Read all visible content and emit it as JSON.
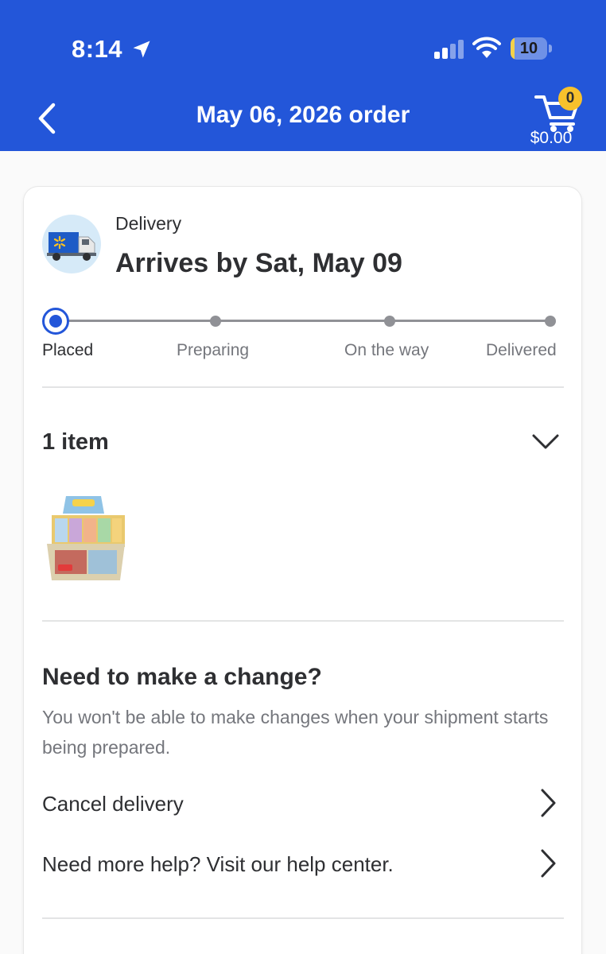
{
  "status_bar": {
    "time": "8:14",
    "battery": "10",
    "battery_level": 0.1
  },
  "header": {
    "title": "May 06, 2026 order",
    "cart_count": "0",
    "cart_total": "$0.00"
  },
  "delivery": {
    "label": "Delivery",
    "arrives": "Arrives by Sat, May 09",
    "steps": [
      "Placed",
      "Preparing",
      "On the way",
      "Delivered"
    ],
    "current_step": 0
  },
  "items": {
    "count_label": "1 item"
  },
  "change": {
    "title": "Need to make a change?",
    "description": "You won't be able to make changes when your shipment starts being prepared.",
    "cancel_label": "Cancel delivery",
    "help_label": "Need more help? Visit our help center."
  },
  "colors": {
    "brand_blue": "#2356d9",
    "badge_yellow": "#f8c12c",
    "track_gray": "#909196"
  }
}
